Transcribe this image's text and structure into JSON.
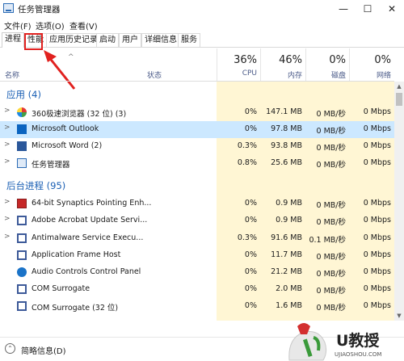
{
  "window": {
    "title": "任务管理器",
    "minimize": "—",
    "maximize": "☐",
    "close": "✕"
  },
  "menu": [
    "文件(F)",
    "选项(O)",
    "查看(V)"
  ],
  "tabs": [
    "进程",
    "性能",
    "应用历史记录",
    "启动",
    "用户",
    "详细信息",
    "服务"
  ],
  "header": {
    "name": "名称",
    "status": "状态",
    "sort_caret": "^",
    "columns": [
      {
        "pct": "36%",
        "label": "CPU"
      },
      {
        "pct": "46%",
        "label": "内存"
      },
      {
        "pct": "0%",
        "label": "磁盘"
      },
      {
        "pct": "0%",
        "label": "网络"
      }
    ]
  },
  "groups": {
    "apps": "应用 (4)",
    "background": "后台进程 (95)"
  },
  "apps": [
    {
      "name": "360极速浏览器 (32 位) (3)",
      "icon": "browser-360-icon",
      "cpu": "0%",
      "mem": "147.1 MB",
      "disk": "0 MB/秒",
      "net": "0 Mbps",
      "expandable": true,
      "selected": false
    },
    {
      "name": "Microsoft Outlook",
      "icon": "outlook-icon",
      "cpu": "0%",
      "mem": "97.8 MB",
      "disk": "0 MB/秒",
      "net": "0 Mbps",
      "expandable": true,
      "selected": true
    },
    {
      "name": "Microsoft Word (2)",
      "icon": "word-icon",
      "cpu": "0.3%",
      "mem": "93.8 MB",
      "disk": "0 MB/秒",
      "net": "0 Mbps",
      "expandable": true,
      "selected": false
    },
    {
      "name": "任务管理器",
      "icon": "task-manager-icon",
      "cpu": "0.8%",
      "mem": "25.6 MB",
      "disk": "0 MB/秒",
      "net": "0 Mbps",
      "expandable": true,
      "selected": false
    }
  ],
  "background": [
    {
      "name": "64-bit Synaptics Pointing Enh...",
      "icon": "synaptics-icon",
      "cpu": "0%",
      "mem": "0.9 MB",
      "disk": "0 MB/秒",
      "net": "0 Mbps",
      "expandable": true
    },
    {
      "name": "Adobe Acrobat Update Servi...",
      "icon": "adobe-icon",
      "cpu": "0%",
      "mem": "0.9 MB",
      "disk": "0 MB/秒",
      "net": "0 Mbps",
      "expandable": true
    },
    {
      "name": "Antimalware Service Execu...",
      "icon": "defender-icon",
      "cpu": "0.3%",
      "mem": "91.6 MB",
      "disk": "0.1 MB/秒",
      "net": "0 Mbps",
      "expandable": true
    },
    {
      "name": "Application Frame Host",
      "icon": "app-frame-icon",
      "cpu": "0%",
      "mem": "11.7 MB",
      "disk": "0 MB/秒",
      "net": "0 Mbps",
      "expandable": false
    },
    {
      "name": "Audio Controls Control Panel",
      "icon": "hp-audio-icon",
      "cpu": "0%",
      "mem": "21.2 MB",
      "disk": "0 MB/秒",
      "net": "0 Mbps",
      "expandable": false
    },
    {
      "name": "COM Surrogate",
      "icon": "com-surrogate-icon",
      "cpu": "0%",
      "mem": "2.0 MB",
      "disk": "0 MB/秒",
      "net": "0 Mbps",
      "expandable": false
    },
    {
      "name": "COM Surrogate (32 位)",
      "icon": "com-surrogate-icon",
      "cpu": "0%",
      "mem": "1.6 MB",
      "disk": "0 MB/秒",
      "net": "0 Mbps",
      "expandable": false
    }
  ],
  "footer": {
    "label": "简略信息(D)",
    "icon": "collapse-up-icon"
  },
  "watermark": {
    "text": "U教授",
    "url": "UJIAOSHOU.COM"
  },
  "colors": {
    "highlight": "#e1211f",
    "group": "#1a5fb4",
    "selected_row": "#cce8ff",
    "column_shade": "#fff6d4"
  }
}
